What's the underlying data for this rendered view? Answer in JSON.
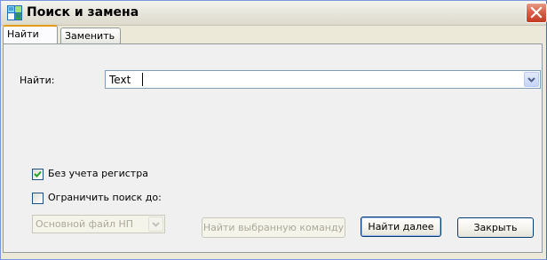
{
  "window": {
    "title": "Поиск и замена"
  },
  "tabs": [
    {
      "label": "Найти",
      "active": true
    },
    {
      "label": "Заменить",
      "active": false
    }
  ],
  "find": {
    "label": "Найти:",
    "value": "Text"
  },
  "options": {
    "ignore_case": {
      "label": "Без учета регистра",
      "checked": true
    },
    "limit_search": {
      "label": "Ограничить поиск до:",
      "checked": false
    }
  },
  "scope_select": {
    "value": "Основной файл НП",
    "disabled": true
  },
  "buttons": {
    "find_selected": "Найти выбранную команду",
    "find_next": "Найти далее",
    "close": "Закрыть"
  },
  "colors": {
    "accent": "#2a5bd7",
    "close_button": "#c23a21"
  }
}
